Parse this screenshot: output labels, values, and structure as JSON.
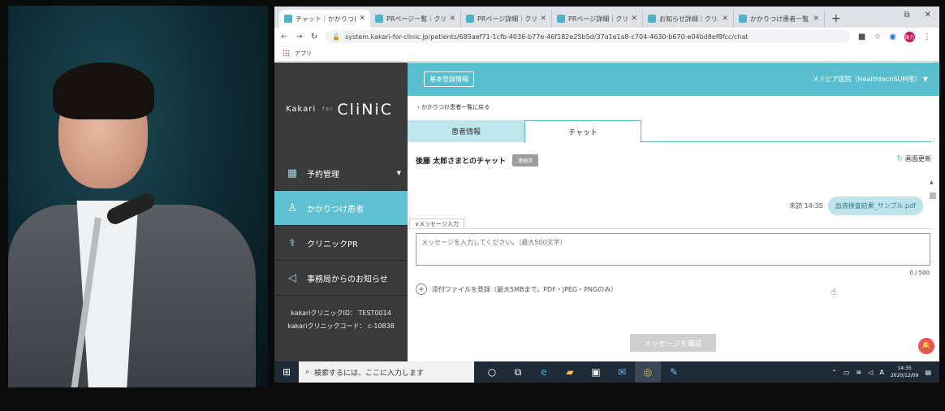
{
  "browser": {
    "tabs": [
      {
        "title": "チャット｜かかりつけ患"
      },
      {
        "title": "PRページ一覧｜クリニ"
      },
      {
        "title": "PRページ詳細｜クリニ"
      },
      {
        "title": "PRページ詳細｜クリニ"
      },
      {
        "title": "お知らせ詳細｜クリニ"
      },
      {
        "title": "かかりつけ患者一覧"
      }
    ],
    "url": "system.kakari-for-clinic.jp/patients/685aef71-1cfb-4036-b77e-46f182e25b5d/37a1e1a8-c704-4630-b670-e04bd8ef8fcc/chat",
    "bookmark_apps": "アプリ",
    "avatar_text": "後方"
  },
  "sidebar": {
    "logo_k": "Kakari",
    "logo_for": "for",
    "logo_clinic": "CliNiC",
    "items": [
      {
        "label": "予約管理",
        "icon": "calendar-icon"
      },
      {
        "label": "かかりつけ患者",
        "icon": "person-icon"
      },
      {
        "label": "クリニックPR",
        "icon": "stethoscope-icon"
      },
      {
        "label": "事務局からのお知らせ",
        "icon": "megaphone-icon"
      }
    ],
    "clinic_id": "kakariクリニックID： TEST0014",
    "clinic_code": "kakariクリニックコード： c-10838"
  },
  "topbar": {
    "basic_info_button": "基本登録情報",
    "user": "メドピア医院（HealthtechSUM用）"
  },
  "main": {
    "back_link": "かかりつけ患者一覧に戻る",
    "tabs": [
      {
        "label": "患者情報"
      },
      {
        "label": "チャット"
      }
    ],
    "chat_title": "後藤 太郎さまとのチャット",
    "status_badge": "連絡済",
    "refresh": "画面更新",
    "message": {
      "meta": "未読 14:35",
      "text": "血液検査結果_サンプル.pdf"
    },
    "input_label": "メッセージ入力",
    "input_placeholder": "メッセージを入力してください。（最大500文字）",
    "counter": "0 / 500",
    "attach": "添付ファイルを登録（最大5MBまで。PDF・JPEG・PNGのみ）",
    "confirm_button": "メッセージを確認"
  },
  "taskbar": {
    "search_placeholder": "検索するには、ここに入力します",
    "ime": "A",
    "time": "14:35",
    "date": "2020/12/09"
  }
}
